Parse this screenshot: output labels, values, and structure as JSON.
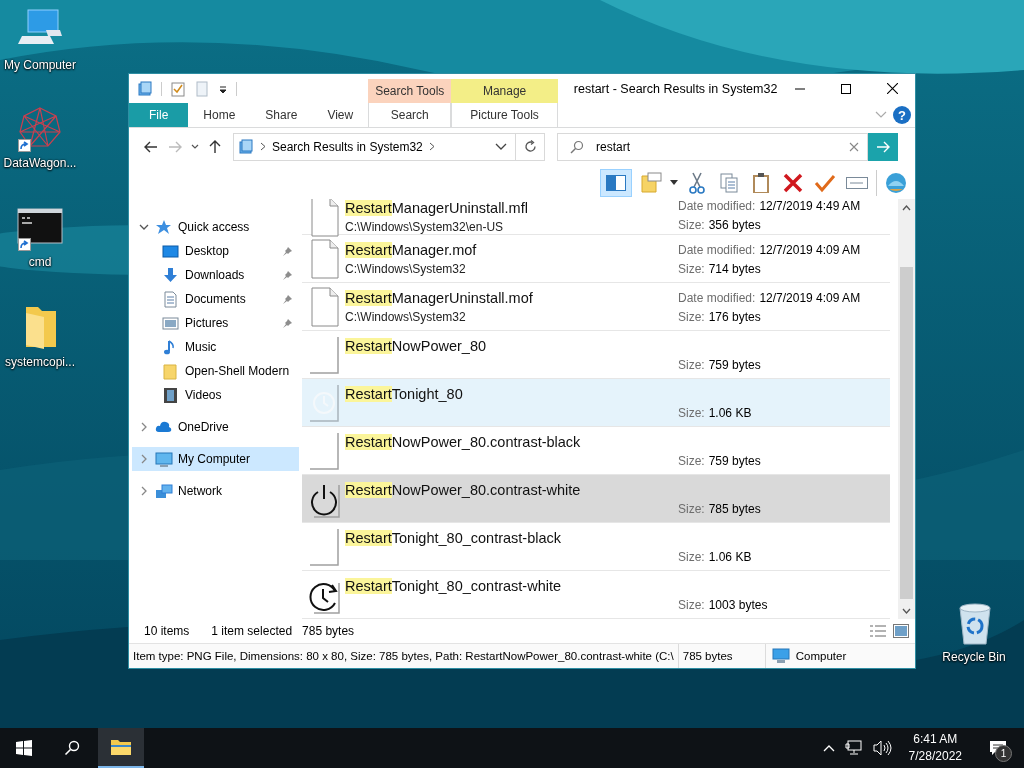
{
  "desktop_icons": [
    {
      "label": "My Computer",
      "kind": "computer",
      "shortcut": false
    },
    {
      "label": "DataWagon...",
      "kind": "web",
      "shortcut": true
    },
    {
      "label": "cmd",
      "kind": "console",
      "shortcut": true
    },
    {
      "label": "systemcopi...",
      "kind": "folder",
      "shortcut": false
    },
    {
      "label": "Recycle Bin",
      "kind": "recycle",
      "shortcut": false
    }
  ],
  "window": {
    "title": "restart - Search Results in System32",
    "ribbon_tabs": [
      {
        "label": "File",
        "kind": "file",
        "selected": false
      },
      {
        "label": "Home",
        "kind": "plain",
        "selected": false
      },
      {
        "label": "Share",
        "kind": "plain",
        "selected": false
      },
      {
        "label": "View",
        "kind": "plain",
        "selected": false
      },
      {
        "label": "Search",
        "kind": "contextual",
        "group": "Search Tools",
        "color": "#fbd3bd",
        "selected": false
      },
      {
        "label": "Picture Tools",
        "kind": "contextual",
        "group": "Manage",
        "color": "#f3ee87",
        "selected": false
      }
    ],
    "help": "?",
    "address": {
      "path": "Search Results in System32"
    },
    "search": {
      "value": "restart"
    },
    "nav": [
      {
        "label": "Quick access",
        "kind": "star",
        "expanded": true,
        "selected": false,
        "children": [
          {
            "label": "Desktop",
            "kind": "desktop",
            "pinned": true,
            "selected": false
          },
          {
            "label": "Downloads",
            "kind": "download",
            "pinned": true,
            "selected": false
          },
          {
            "label": "Documents",
            "kind": "document",
            "pinned": true,
            "selected": false
          },
          {
            "label": "Pictures",
            "kind": "picture",
            "pinned": true,
            "selected": false
          },
          {
            "label": "Music",
            "kind": "music",
            "pinned": false,
            "selected": false
          },
          {
            "label": "Open-Shell Modern",
            "kind": "folder",
            "pinned": false,
            "selected": false
          },
          {
            "label": "Videos",
            "kind": "video",
            "pinned": false,
            "selected": false
          }
        ]
      },
      {
        "label": "OneDrive",
        "kind": "cloud",
        "expanded": false,
        "selected": false
      },
      {
        "label": "My Computer",
        "kind": "computer",
        "expanded": false,
        "selected": true
      },
      {
        "label": "Network",
        "kind": "network",
        "expanded": false,
        "selected": false
      }
    ],
    "files": [
      {
        "name": "RestartManagerUninstall.mfl",
        "path": "C:\\Windows\\System32\\en-US",
        "date_label": "Date modified:",
        "date": "12/7/2019 4:49 AM",
        "size_label": "Size:",
        "size": "356 bytes",
        "kind": "document",
        "selected": false,
        "hovered": false
      },
      {
        "name": "RestartManager.mof",
        "path": "C:\\Windows\\System32",
        "date_label": "Date modified:",
        "date": "12/7/2019 4:09 AM",
        "size_label": "Size:",
        "size": "714 bytes",
        "kind": "document",
        "selected": false,
        "hovered": false
      },
      {
        "name": "RestartManagerUninstall.mof",
        "path": "C:\\Windows\\System32",
        "date_label": "Date modified:",
        "date": "12/7/2019 4:09 AM",
        "size_label": "Size:",
        "size": "176 bytes",
        "kind": "document",
        "selected": false,
        "hovered": false
      },
      {
        "name": "RestartNowPower_80",
        "size_label": "Size:",
        "size": "759 bytes",
        "kind": "blank",
        "selected": false,
        "hovered": false
      },
      {
        "name": "RestartTonight_80",
        "size_label": "Size:",
        "size": "1.06 KB",
        "kind": "faint-clock",
        "selected": false,
        "hovered": true
      },
      {
        "name": "RestartNowPower_80.contrast-black",
        "size_label": "Size:",
        "size": "759 bytes",
        "kind": "blank",
        "selected": false,
        "hovered": false
      },
      {
        "name": "RestartNowPower_80.contrast-white",
        "size_label": "Size:",
        "size": "785 bytes",
        "kind": "power",
        "selected": true,
        "hovered": false
      },
      {
        "name": "RestartTonight_80_contrast-black",
        "size_label": "Size:",
        "size": "1.06 KB",
        "kind": "blank",
        "selected": false,
        "hovered": false
      },
      {
        "name": "RestartTonight_80_contrast-white",
        "size_label": "Size:",
        "size": "1003 bytes",
        "kind": "clock",
        "selected": false,
        "hovered": false
      }
    ],
    "status": {
      "count": "10 items",
      "selection": "1 item selected",
      "size": "785 bytes"
    },
    "details": {
      "info": "Item type: PNG File, Dimensions: 80 x 80, Size: 785 bytes, Path: RestartNowPower_80.contrast-white (C:\\",
      "size": "785 bytes",
      "location": "Computer"
    }
  },
  "taskbar": {
    "time": "6:41 AM",
    "date": "7/28/2022",
    "notifications": "1"
  }
}
